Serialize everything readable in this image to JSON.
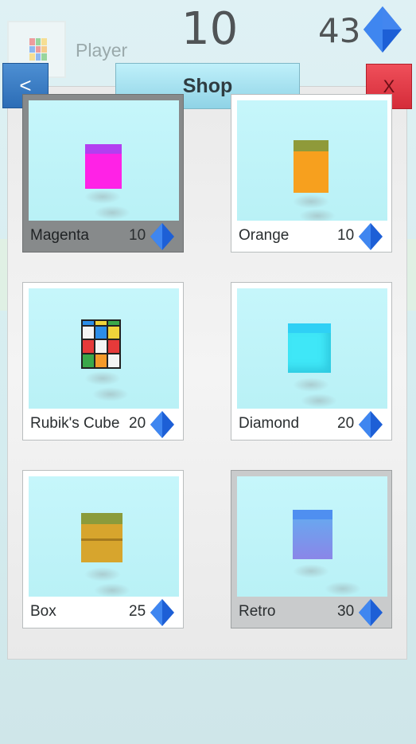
{
  "hud": {
    "player_name": "Player",
    "score": "10",
    "gems": "43"
  },
  "shop": {
    "title": "Shop",
    "back_label": "<",
    "close_label": "X",
    "items": [
      {
        "name": "Magenta",
        "price": "10",
        "state": "selected",
        "color": "#ff22e6"
      },
      {
        "name": "Orange",
        "price": "10",
        "state": "locked",
        "color": "#f7a01e"
      },
      {
        "name": "Rubik's Cube",
        "price": "20",
        "state": "locked",
        "color": "#ffffff"
      },
      {
        "name": "Diamond",
        "price": "20",
        "state": "locked",
        "color": "#3fe7f7"
      },
      {
        "name": "Box",
        "price": "25",
        "state": "locked",
        "color": "#d7a52d"
      },
      {
        "name": "Retro",
        "price": "30",
        "state": "owned",
        "color": "#7f8ff0"
      }
    ]
  },
  "colors": {
    "gem": "#1e63d8",
    "back_button": "#3a7fc8",
    "close_button": "#e23c48",
    "title_bar": "#a8e3f1"
  }
}
